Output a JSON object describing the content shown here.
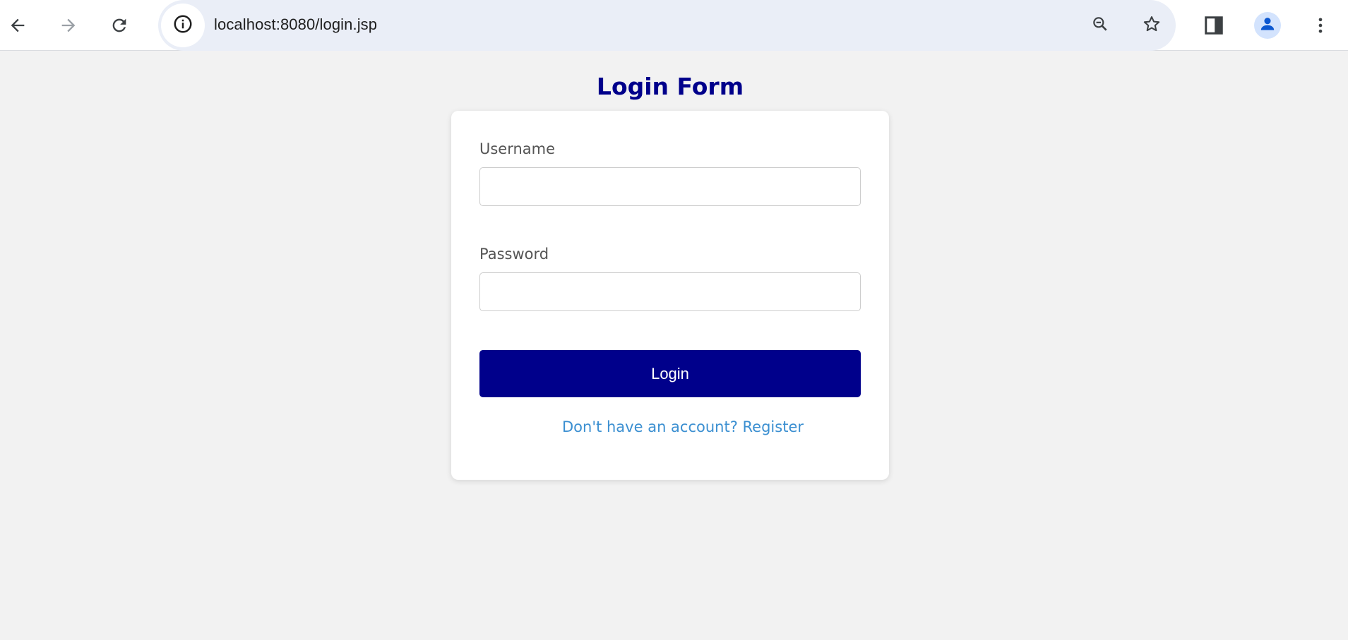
{
  "browser": {
    "url": "localhost:8080/login.jsp",
    "icons": {
      "back": "arrow-left-icon",
      "forward": "arrow-right-icon",
      "reload": "reload-icon",
      "site_info": "info-icon",
      "zoom": "zoom-out-icon",
      "bookmark": "star-icon",
      "side_panel": "side-panel-icon",
      "profile": "person-icon",
      "menu": "kebab-menu-icon"
    }
  },
  "page": {
    "title": "Login Form",
    "username_label": "Username",
    "username_value": "",
    "password_label": "Password",
    "password_value": "",
    "login_button": "Login",
    "register_link": "Don't have an account? Register"
  },
  "colors": {
    "background": "#f2f2f2",
    "card": "#ffffff",
    "title": "#00008b",
    "button": "#00008b",
    "link": "#3b8fd1",
    "omnibox": "#eaeef7"
  }
}
